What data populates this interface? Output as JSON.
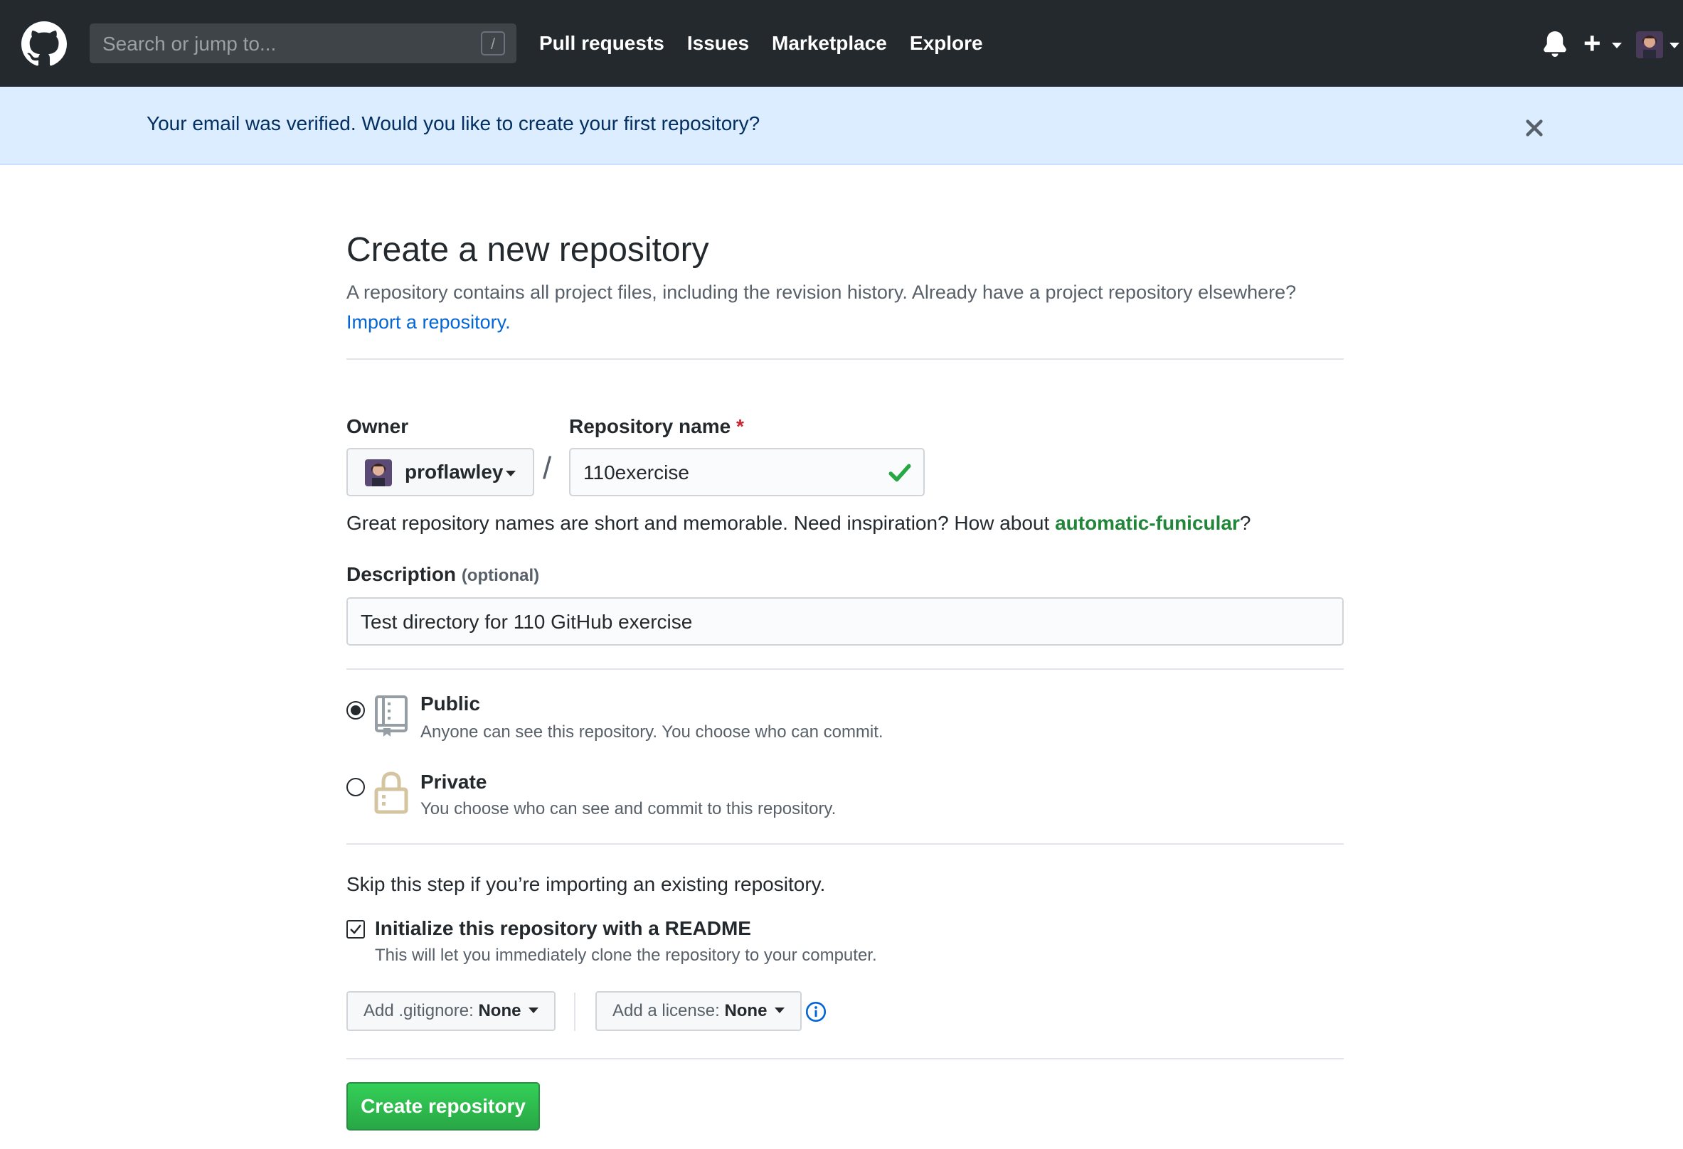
{
  "header": {
    "search_placeholder": "Search or jump to...",
    "search_shortcut": "/",
    "nav": [
      "Pull requests",
      "Issues",
      "Marketplace",
      "Explore"
    ],
    "plus_label": "+"
  },
  "flash": {
    "message": "Your email was verified. Would you like to create your first repository?"
  },
  "page": {
    "title": "Create a new repository",
    "subtitle": "A repository contains all project files, including the revision history. Already have a project repository elsewhere?",
    "import_link": "Import a repository."
  },
  "form": {
    "owner_label": "Owner",
    "owner_value": "proflawley",
    "separator": "/",
    "repo_label": "Repository name",
    "required_mark": "*",
    "repo_value": "110exercise",
    "hint_prefix": "Great repository names are short and memorable. Need inspiration? How about",
    "hint_suggestion": "automatic-funicular",
    "hint_suffix": "?",
    "description_label": "Description",
    "description_optional": "(optional)",
    "description_value": "Test directory for 110 GitHub exercise",
    "visibility": {
      "public_title": "Public",
      "public_desc": "Anyone can see this repository. You choose who can commit.",
      "private_title": "Private",
      "private_desc": "You choose who can see and commit to this repository.",
      "selected": "public"
    },
    "skip_text": "Skip this step if you’re importing an existing repository.",
    "init_label": "Initialize this repository with a README",
    "init_desc": "This will let you immediately clone the repository to your computer.",
    "init_checked": true,
    "gitignore_label": "Add .gitignore:",
    "gitignore_value": "None",
    "license_label": "Add a license:",
    "license_value": "None",
    "submit_label": "Create repository"
  },
  "colors": {
    "header_bg": "#24292e",
    "flash_bg": "#dbedff",
    "link": "#0366d6",
    "success": "#28a745",
    "suggestion": "#22863a"
  }
}
